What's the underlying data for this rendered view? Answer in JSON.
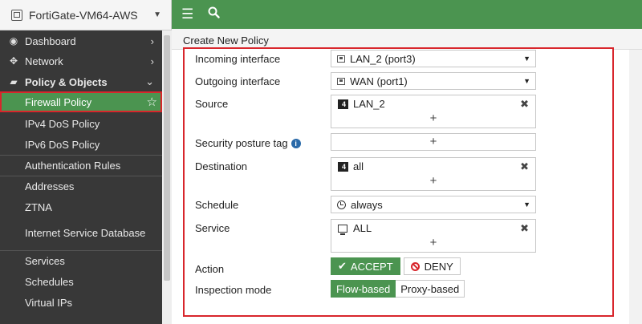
{
  "device": {
    "name": "FortiGate-VM64-AWS",
    "icon": "device-icon"
  },
  "sidebar": {
    "items": [
      {
        "label": "Dashboard",
        "icon": "dashboard-icon",
        "chevron": ">"
      },
      {
        "label": "Network",
        "icon": "network-icon",
        "chevron": ">"
      },
      {
        "label": "Policy & Objects",
        "icon": "policy-icon",
        "chevron": "v"
      },
      {
        "label": "Firewall Policy",
        "icon": "star-icon"
      },
      {
        "label": "IPv4 DoS Policy"
      },
      {
        "label": "IPv6 DoS Policy"
      },
      {
        "label": "Authentication Rules"
      },
      {
        "label": "Addresses"
      },
      {
        "label": "ZTNA"
      },
      {
        "label": "Internet Service Database"
      },
      {
        "label": "Services"
      },
      {
        "label": "Schedules"
      },
      {
        "label": "Virtual IPs"
      }
    ]
  },
  "topbar": {
    "menu_icon": "menu-icon",
    "search_icon": "search-icon",
    "color": "#4b9450"
  },
  "page": {
    "title": "Create New Policy"
  },
  "form": {
    "incoming_label": "Incoming interface",
    "incoming_value": "LAN_2 (port3)",
    "outgoing_label": "Outgoing interface",
    "outgoing_value": "WAN (port1)",
    "source_label": "Source",
    "source_value": "LAN_2",
    "posture_label": "Security posture tag",
    "destination_label": "Destination",
    "destination_value": "all",
    "schedule_label": "Schedule",
    "schedule_value": "always",
    "service_label": "Service",
    "service_value": "ALL",
    "action_label": "Action",
    "accept_label": "ACCEPT",
    "deny_label": "DENY",
    "inspection_label": "Inspection mode",
    "flow_label": "Flow-based",
    "proxy_label": "Proxy-based",
    "add_symbol": "+",
    "remove_symbol": "✖"
  },
  "colors": {
    "accent": "#4b9450",
    "highlight": "#d8262c",
    "sidebar_bg": "#383838"
  }
}
